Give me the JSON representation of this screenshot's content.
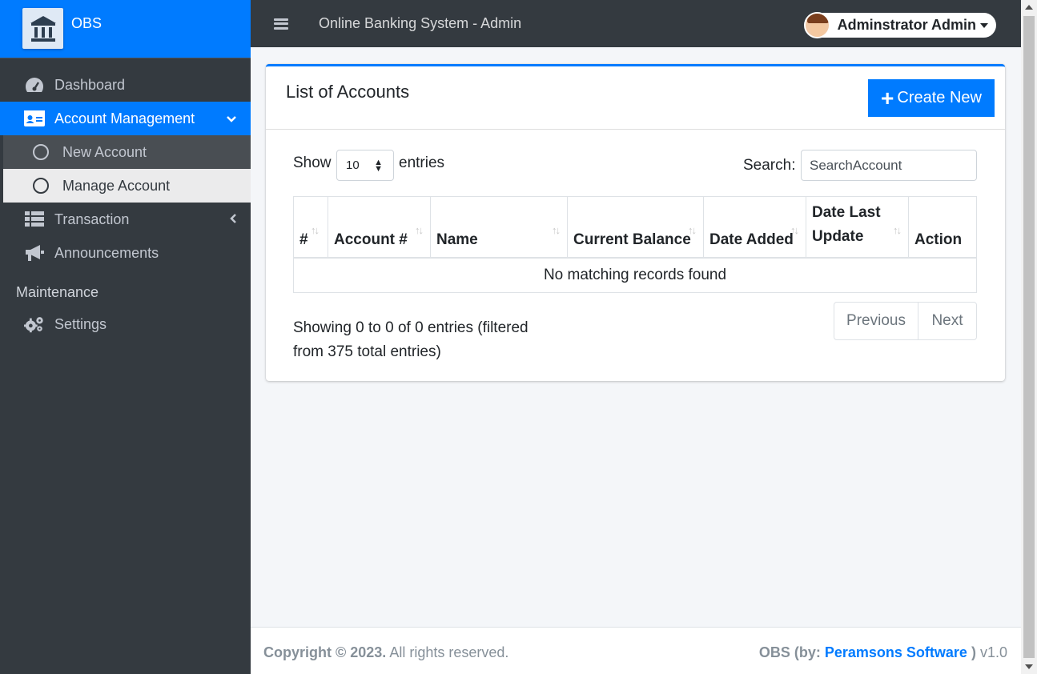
{
  "brand": {
    "name": "OBS"
  },
  "sidebar": {
    "items": [
      {
        "label": "Dashboard",
        "icon": "tachometer-icon"
      },
      {
        "label": "Account Management",
        "icon": "id-card-icon",
        "active": true
      },
      {
        "label": "New Account",
        "icon": "circle-icon"
      },
      {
        "label": "Manage Account",
        "icon": "circle-icon"
      },
      {
        "label": "Transaction",
        "icon": "table-icon"
      },
      {
        "label": "Announcements",
        "icon": "bullhorn-icon"
      }
    ],
    "section_header": "Maintenance",
    "maintenance_items": [
      {
        "label": "Settings",
        "icon": "cogs-icon"
      }
    ]
  },
  "topbar": {
    "title": "Online Banking System - Admin",
    "user_name": "Adminstrator Admin"
  },
  "card": {
    "title": "List of Accounts",
    "create_label": "Create New",
    "show_label": "Show",
    "entries_value": "10",
    "entries_label": "entries",
    "search_label": "Search:",
    "search_value": "SearchAccount",
    "columns": [
      "#",
      "Account #",
      "Name",
      "Current Balance",
      "Date Added",
      "Date Last Update",
      "Action"
    ],
    "empty_message": "No matching records found",
    "info": "Showing 0 to 0 of 0 entries (filtered from 375 total entries)",
    "prev_label": "Previous",
    "next_label": "Next"
  },
  "footer": {
    "copyright": "Copyright © 2023.",
    "rights": "All rights reserved.",
    "right_prefix": "OBS (by:",
    "right_link": "Peramsons Software",
    "right_suffix": ")",
    "version": "v1.0"
  },
  "colors": {
    "primary": "#007bff",
    "sidebar_bg": "#343a40",
    "content_bg": "#f4f6f9"
  }
}
